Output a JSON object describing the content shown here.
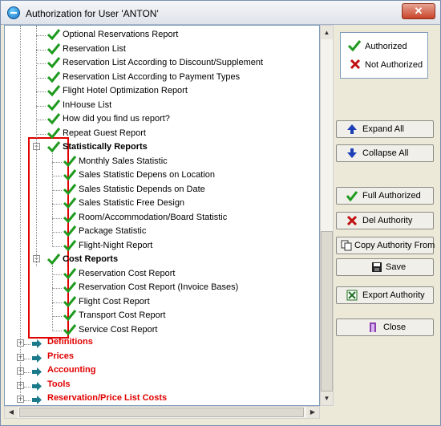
{
  "window": {
    "title": "Authorization for User 'ANTON'",
    "close_label": "✕"
  },
  "tree": {
    "items_top": [
      "Optional Reservations Report",
      "Reservation List",
      "Reservation List According to Discount/Supplement",
      "Reservation List According to Payment Types",
      "Flight Hotel Optimization Report",
      "InHouse List",
      "How did you find us report?",
      "Repeat Guest Report"
    ],
    "statistically": {
      "label": "Statistically Reports",
      "children": [
        "Monthly Sales Statistic",
        "Sales Statistic Depens on Location",
        "Sales Statistic Depends on Date",
        "Sales Statistic Free Design",
        "Room/Accommodation/Board Statistic",
        "Package Statistic",
        "Flight-Night Report"
      ]
    },
    "cost": {
      "label": "Cost Reports",
      "children": [
        "Reservation Cost Report",
        "Reservation Cost Report (Invoice Bases)",
        "Flight Cost Report",
        "Transport Cost Report",
        "Service Cost Report"
      ]
    },
    "categories": [
      "Definitions",
      "Prices",
      "Accounting",
      "Tools",
      "Reservation/Price List Costs"
    ]
  },
  "legend": {
    "authorized": "Authorized",
    "not_authorized": "Not Authorized"
  },
  "buttons": {
    "expand_all": "Expand All",
    "collapse_all": "Collapse All",
    "full_authorized": "Full Authorized",
    "del_authority": "Del Authority",
    "copy_authority_from": "Copy Authority From",
    "save": "Save",
    "export_authority": "Export Authority",
    "close": "Close"
  },
  "colors": {
    "check": "#1e9a1e",
    "category_text": "#e00000",
    "highlight": "#e00000"
  }
}
